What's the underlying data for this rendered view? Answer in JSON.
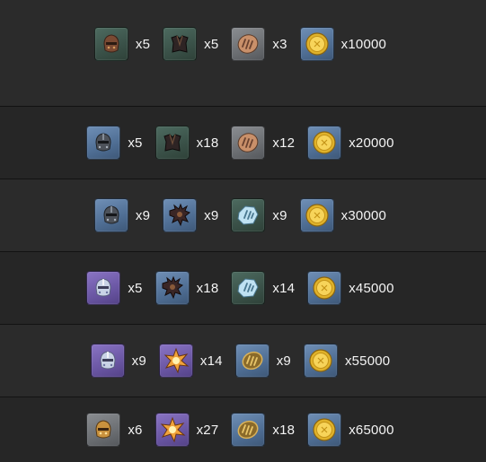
{
  "rewards": [
    {
      "items": [
        {
          "icon": "helmet-bronze-icon",
          "tier": "green",
          "qty": "x5"
        },
        {
          "icon": "armor-dark-icon",
          "tier": "green",
          "qty": "x5"
        },
        {
          "icon": "fossil-shell-icon",
          "tier": "gray",
          "qty": "x3"
        },
        {
          "icon": "gold-coin-icon",
          "tier": "blue",
          "qty": "x10000"
        }
      ]
    },
    {
      "items": [
        {
          "icon": "helmet-steel-icon",
          "tier": "blue",
          "qty": "x5"
        },
        {
          "icon": "armor-dark-icon",
          "tier": "green",
          "qty": "x18"
        },
        {
          "icon": "fossil-shell-icon",
          "tier": "gray",
          "qty": "x12"
        },
        {
          "icon": "gold-coin-icon",
          "tier": "blue",
          "qty": "x20000"
        }
      ]
    },
    {
      "items": [
        {
          "icon": "helmet-steel-icon",
          "tier": "blue",
          "qty": "x9"
        },
        {
          "icon": "armor-spiked-icon",
          "tier": "blue",
          "qty": "x9"
        },
        {
          "icon": "fossil-crystal-icon",
          "tier": "green",
          "qty": "x9"
        },
        {
          "icon": "gold-coin-icon",
          "tier": "blue",
          "qty": "x30000"
        }
      ]
    },
    {
      "items": [
        {
          "icon": "helmet-silver-icon",
          "tier": "purple",
          "qty": "x5"
        },
        {
          "icon": "armor-spiked-icon",
          "tier": "blue",
          "qty": "x18"
        },
        {
          "icon": "fossil-crystal-icon",
          "tier": "green",
          "qty": "x14"
        },
        {
          "icon": "gold-coin-icon",
          "tier": "blue",
          "qty": "x45000"
        }
      ]
    },
    {
      "items": [
        {
          "icon": "helmet-silver-icon",
          "tier": "purple",
          "qty": "x9"
        },
        {
          "icon": "armor-explosion-icon",
          "tier": "purple",
          "qty": "x14"
        },
        {
          "icon": "fossil-gold-icon",
          "tier": "blue",
          "qty": "x9"
        },
        {
          "icon": "gold-coin-icon",
          "tier": "blue",
          "qty": "x55000"
        }
      ]
    },
    {
      "items": [
        {
          "icon": "helmet-gold-icon",
          "tier": "gray",
          "qty": "x6"
        },
        {
          "icon": "armor-explosion-icon",
          "tier": "purple",
          "qty": "x27"
        },
        {
          "icon": "fossil-gold-icon",
          "tier": "blue",
          "qty": "x18"
        },
        {
          "icon": "gold-coin-icon",
          "tier": "blue",
          "qty": "x65000"
        }
      ]
    }
  ]
}
